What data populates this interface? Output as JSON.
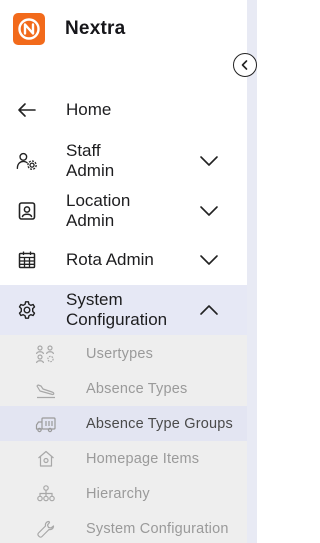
{
  "brand": {
    "name": "Nextra",
    "logo_icon": "nextra-logo-icon",
    "logo_color": "#f26a1b"
  },
  "collapse": {
    "icon": "chevron-left-circle-icon"
  },
  "nav": {
    "home": {
      "label": "Home",
      "icon": "arrow-left-icon"
    },
    "staff": {
      "label_line1": "Staff",
      "label_line2": "Admin",
      "icon": "users-gear-icon",
      "expanded": false
    },
    "location": {
      "label_line1": "Location",
      "label_line2": "Admin",
      "icon": "id-card-icon",
      "expanded": false
    },
    "rota": {
      "label": "Rota Admin",
      "icon": "calendar-icon",
      "expanded": false
    },
    "system": {
      "label_line1": "System",
      "label_line2": "Configuration",
      "icon": "gear-icon",
      "expanded": true,
      "selected_bg": "#e6e8f5"
    }
  },
  "submenu": {
    "items": [
      {
        "label": "Usertypes",
        "icon": "usertypes-icon",
        "active": false
      },
      {
        "label": "Absence Types",
        "icon": "plane-landing-icon",
        "active": false
      },
      {
        "label": "Absence Type Groups",
        "icon": "truck-icon",
        "active": true
      },
      {
        "label": "Homepage Items",
        "icon": "home-icon",
        "active": false
      },
      {
        "label": "Hierarchy",
        "icon": "hierarchy-icon",
        "active": false
      },
      {
        "label": "System Configuration",
        "icon": "wrench-icon",
        "active": false
      }
    ]
  }
}
